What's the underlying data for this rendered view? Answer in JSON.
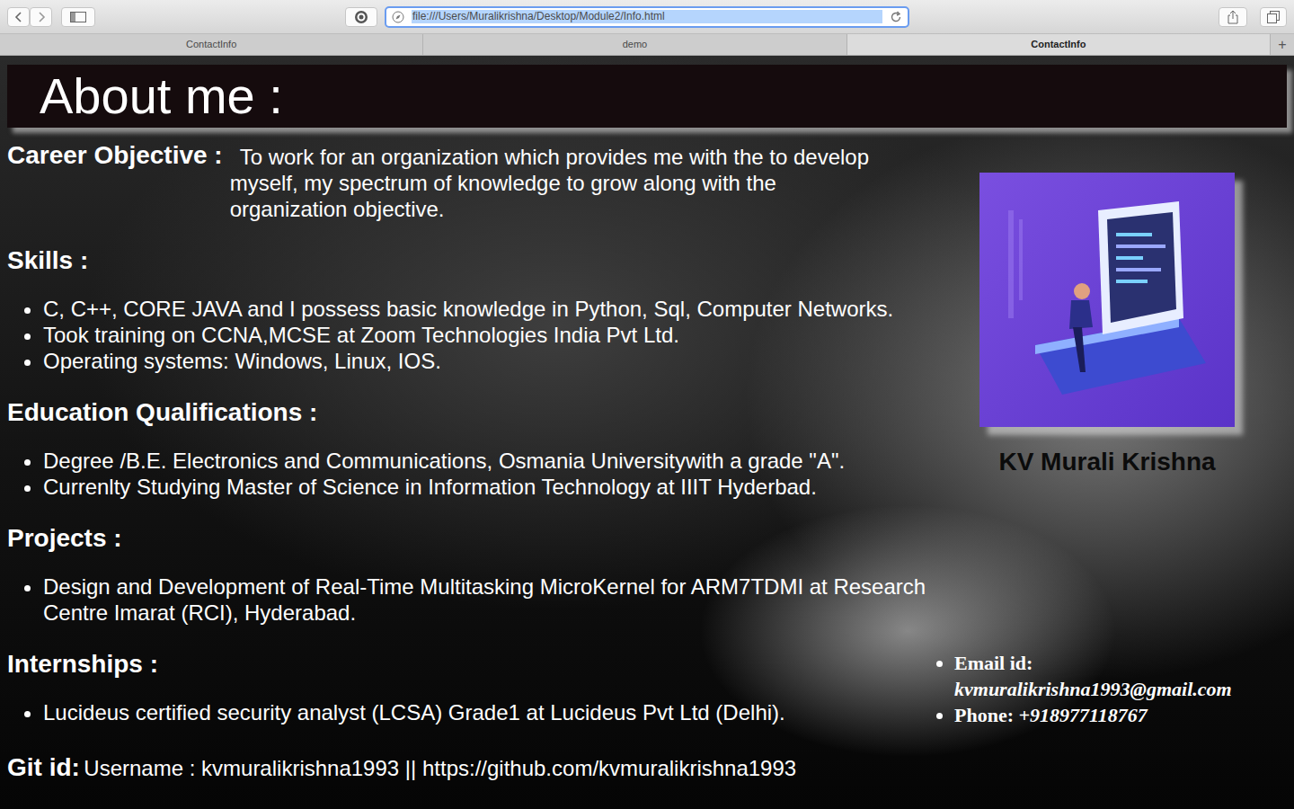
{
  "window": {
    "url": "file:///Users/Muralikrishna/Desktop/Module2/Info.html"
  },
  "tabs": [
    {
      "label": "ContactInfo",
      "selected": false
    },
    {
      "label": "demo",
      "selected": false
    },
    {
      "label": "ContactInfo",
      "selected": true
    }
  ],
  "new_tab": "+",
  "page": {
    "heading": "About me :",
    "objective": {
      "label": "Career Objective :",
      "text": "To work for an organization which provides me with the to develop myself, my spectrum of knowledge to grow along with the organization objective."
    },
    "sections": [
      {
        "title": "Skills :",
        "items": [
          "C, C++, CORE JAVA and I possess basic knowledge in Python, Sql, Computer Networks.",
          "Took training on CCNA,MCSE at Zoom Technologies India Pvt Ltd.",
          "Operating systems: Windows, Linux, IOS."
        ]
      },
      {
        "title": "Education Qualifications :",
        "items": [
          "Degree /B.E. Electronics and Communications, Osmania Universitywith a grade \"A\".",
          "Currenlty Studying Master of Science in Information Technology at IIIT Hyderbad."
        ]
      },
      {
        "title": "Projects :",
        "items": [
          "Design and Development of Real-Time Multitasking MicroKernel for ARM7TDMI at Research Centre Imarat (RCI), Hyderabad."
        ]
      },
      {
        "title": "Internships :",
        "items": [
          "Lucideus certified security analyst (LCSA) Grade1 at Lucideus Pvt Ltd (Delhi)."
        ]
      }
    ],
    "git": {
      "label": "Git id:",
      "text": "Username : kvmuralikrishna1993 || https://github.com/kvmuralikrishna1993"
    },
    "profile": {
      "name": "KV Murali Krishna"
    },
    "contacts": [
      {
        "label": "Email id:",
        "value": "kvmuralikrishna1993@gmail.com"
      },
      {
        "label": "Phone:",
        "value": "+918977118767"
      }
    ]
  }
}
